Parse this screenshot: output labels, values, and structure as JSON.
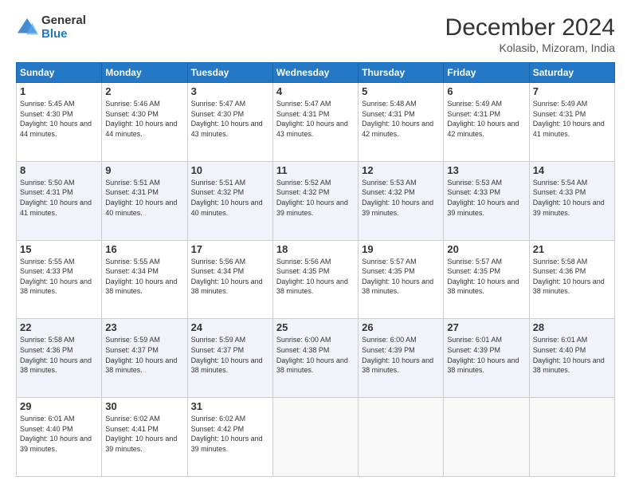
{
  "logo": {
    "general": "General",
    "blue": "Blue"
  },
  "header": {
    "month": "December 2024",
    "location": "Kolasib, Mizoram, India"
  },
  "weekdays": [
    "Sunday",
    "Monday",
    "Tuesday",
    "Wednesday",
    "Thursday",
    "Friday",
    "Saturday"
  ],
  "weeks": [
    [
      {
        "day": "1",
        "sunrise": "5:45 AM",
        "sunset": "4:30 PM",
        "daylight": "10 hours and 44 minutes."
      },
      {
        "day": "2",
        "sunrise": "5:46 AM",
        "sunset": "4:30 PM",
        "daylight": "10 hours and 44 minutes."
      },
      {
        "day": "3",
        "sunrise": "5:47 AM",
        "sunset": "4:30 PM",
        "daylight": "10 hours and 43 minutes."
      },
      {
        "day": "4",
        "sunrise": "5:47 AM",
        "sunset": "4:31 PM",
        "daylight": "10 hours and 43 minutes."
      },
      {
        "day": "5",
        "sunrise": "5:48 AM",
        "sunset": "4:31 PM",
        "daylight": "10 hours and 42 minutes."
      },
      {
        "day": "6",
        "sunrise": "5:49 AM",
        "sunset": "4:31 PM",
        "daylight": "10 hours and 42 minutes."
      },
      {
        "day": "7",
        "sunrise": "5:49 AM",
        "sunset": "4:31 PM",
        "daylight": "10 hours and 41 minutes."
      }
    ],
    [
      {
        "day": "8",
        "sunrise": "5:50 AM",
        "sunset": "4:31 PM",
        "daylight": "10 hours and 41 minutes."
      },
      {
        "day": "9",
        "sunrise": "5:51 AM",
        "sunset": "4:31 PM",
        "daylight": "10 hours and 40 minutes."
      },
      {
        "day": "10",
        "sunrise": "5:51 AM",
        "sunset": "4:32 PM",
        "daylight": "10 hours and 40 minutes."
      },
      {
        "day": "11",
        "sunrise": "5:52 AM",
        "sunset": "4:32 PM",
        "daylight": "10 hours and 39 minutes."
      },
      {
        "day": "12",
        "sunrise": "5:53 AM",
        "sunset": "4:32 PM",
        "daylight": "10 hours and 39 minutes."
      },
      {
        "day": "13",
        "sunrise": "5:53 AM",
        "sunset": "4:33 PM",
        "daylight": "10 hours and 39 minutes."
      },
      {
        "day": "14",
        "sunrise": "5:54 AM",
        "sunset": "4:33 PM",
        "daylight": "10 hours and 39 minutes."
      }
    ],
    [
      {
        "day": "15",
        "sunrise": "5:55 AM",
        "sunset": "4:33 PM",
        "daylight": "10 hours and 38 minutes."
      },
      {
        "day": "16",
        "sunrise": "5:55 AM",
        "sunset": "4:34 PM",
        "daylight": "10 hours and 38 minutes."
      },
      {
        "day": "17",
        "sunrise": "5:56 AM",
        "sunset": "4:34 PM",
        "daylight": "10 hours and 38 minutes."
      },
      {
        "day": "18",
        "sunrise": "5:56 AM",
        "sunset": "4:35 PM",
        "daylight": "10 hours and 38 minutes."
      },
      {
        "day": "19",
        "sunrise": "5:57 AM",
        "sunset": "4:35 PM",
        "daylight": "10 hours and 38 minutes."
      },
      {
        "day": "20",
        "sunrise": "5:57 AM",
        "sunset": "4:35 PM",
        "daylight": "10 hours and 38 minutes."
      },
      {
        "day": "21",
        "sunrise": "5:58 AM",
        "sunset": "4:36 PM",
        "daylight": "10 hours and 38 minutes."
      }
    ],
    [
      {
        "day": "22",
        "sunrise": "5:58 AM",
        "sunset": "4:36 PM",
        "daylight": "10 hours and 38 minutes."
      },
      {
        "day": "23",
        "sunrise": "5:59 AM",
        "sunset": "4:37 PM",
        "daylight": "10 hours and 38 minutes."
      },
      {
        "day": "24",
        "sunrise": "5:59 AM",
        "sunset": "4:37 PM",
        "daylight": "10 hours and 38 minutes."
      },
      {
        "day": "25",
        "sunrise": "6:00 AM",
        "sunset": "4:38 PM",
        "daylight": "10 hours and 38 minutes."
      },
      {
        "day": "26",
        "sunrise": "6:00 AM",
        "sunset": "4:39 PM",
        "daylight": "10 hours and 38 minutes."
      },
      {
        "day": "27",
        "sunrise": "6:01 AM",
        "sunset": "4:39 PM",
        "daylight": "10 hours and 38 minutes."
      },
      {
        "day": "28",
        "sunrise": "6:01 AM",
        "sunset": "4:40 PM",
        "daylight": "10 hours and 38 minutes."
      }
    ],
    [
      {
        "day": "29",
        "sunrise": "6:01 AM",
        "sunset": "4:40 PM",
        "daylight": "10 hours and 39 minutes."
      },
      {
        "day": "30",
        "sunrise": "6:02 AM",
        "sunset": "4:41 PM",
        "daylight": "10 hours and 39 minutes."
      },
      {
        "day": "31",
        "sunrise": "6:02 AM",
        "sunset": "4:42 PM",
        "daylight": "10 hours and 39 minutes."
      },
      null,
      null,
      null,
      null
    ]
  ]
}
